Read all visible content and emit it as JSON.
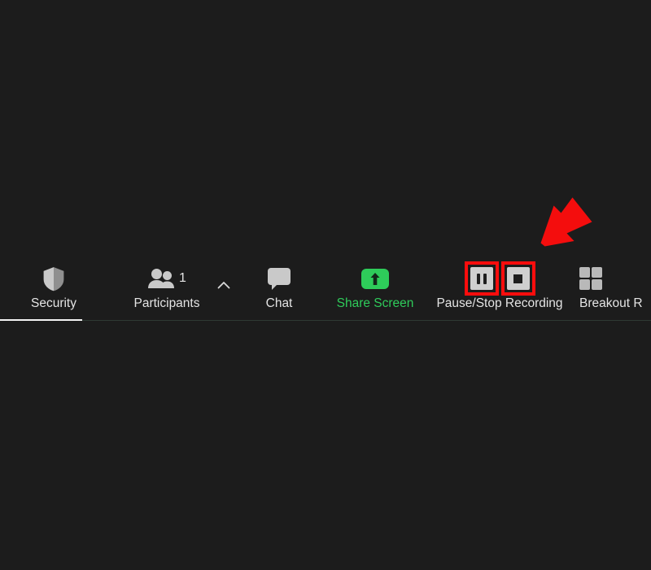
{
  "window": {
    "background_color": "#1c1c1c",
    "accent_green": "#2ecc5a",
    "highlight_red": "#fc0d0d",
    "label_color": "#e4e4e4"
  },
  "annotation": {
    "arrow_name": "red-arrow-pointing-down-left",
    "color": "#f40d0d",
    "target": "Pause/Stop Recording"
  },
  "toolbar": {
    "items": [
      {
        "id": "security",
        "label": "Security",
        "icon": "shield-icon"
      },
      {
        "id": "participants",
        "label": "Participants",
        "icon": "participants-icon",
        "count": "1",
        "caret": "chevron-up-icon"
      },
      {
        "id": "chat",
        "label": "Chat",
        "icon": "speech-bubble-icon"
      },
      {
        "id": "share-screen",
        "label": "Share Screen",
        "icon": "upload-arrow-icon"
      },
      {
        "id": "recording",
        "label": "Pause/Stop Recording",
        "pause_icon": "pause-icon",
        "stop_icon": "stop-icon"
      },
      {
        "id": "breakout-rooms",
        "label": "Breakout R",
        "icon": "grid-four-squares-icon"
      }
    ]
  }
}
